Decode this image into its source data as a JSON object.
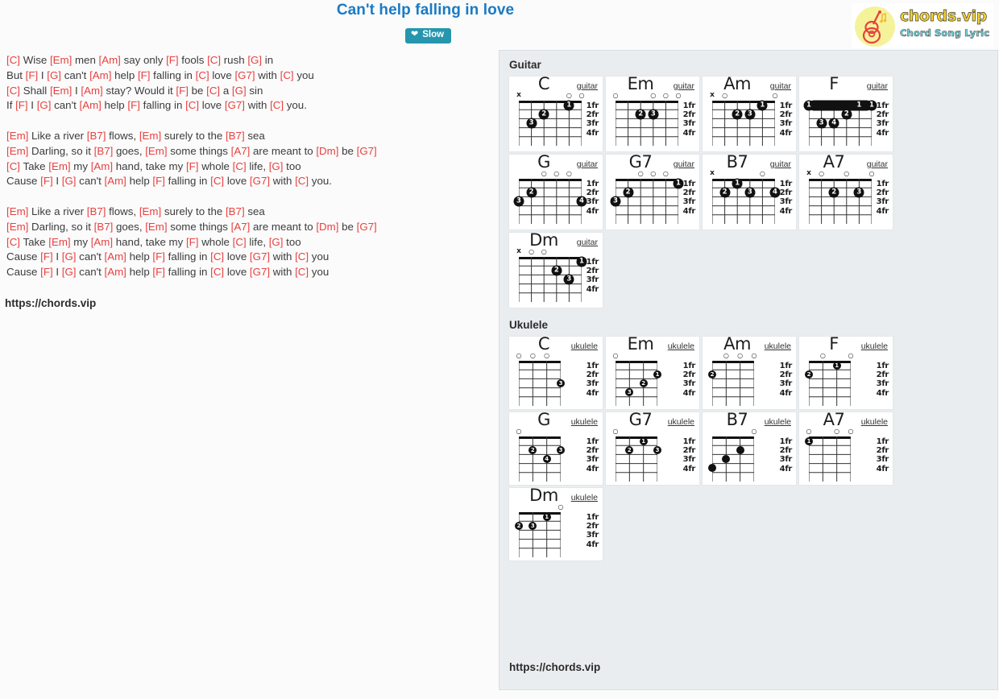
{
  "header": {
    "title": "Can't help falling in love",
    "slow_button": {
      "label": "Slow",
      "icon": "heart-beat-icon",
      "color": "#2596ae"
    }
  },
  "logo": {
    "name": "chords.vip",
    "tagline": "Chord Song Lyric",
    "icon": "guitar-icon",
    "name_color": "#f6d32d",
    "tagline_color": "#6fe0e8",
    "disc_color": "#f4f39a"
  },
  "colors": {
    "title": "#1a7ac4",
    "chord": "#e8413f",
    "panel_bg": "#e9edef"
  },
  "lyrics": {
    "url": "https://chords.vip",
    "lines": [
      [
        [
          "c",
          "[C]"
        ],
        [
          "t",
          " Wise "
        ],
        [
          "c",
          "[Em]"
        ],
        [
          "t",
          " men "
        ],
        [
          "c",
          "[Am]"
        ],
        [
          "t",
          " say only "
        ],
        [
          "c",
          "[F]"
        ],
        [
          "t",
          " fools "
        ],
        [
          "c",
          "[C]"
        ],
        [
          "t",
          " rush "
        ],
        [
          "c",
          "[G]"
        ],
        [
          "t",
          " in"
        ]
      ],
      [
        [
          "t",
          "But "
        ],
        [
          "c",
          "[F]"
        ],
        [
          "t",
          " I "
        ],
        [
          "c",
          "[G]"
        ],
        [
          "t",
          " can't "
        ],
        [
          "c",
          "[Am]"
        ],
        [
          "t",
          " help "
        ],
        [
          "c",
          "[F]"
        ],
        [
          "t",
          " falling in "
        ],
        [
          "c",
          "[C]"
        ],
        [
          "t",
          " love "
        ],
        [
          "c",
          "[G7]"
        ],
        [
          "t",
          " with "
        ],
        [
          "c",
          "[C]"
        ],
        [
          "t",
          " you"
        ]
      ],
      [
        [
          "c",
          "[C]"
        ],
        [
          "t",
          " Shall "
        ],
        [
          "c",
          "[Em]"
        ],
        [
          "t",
          " I "
        ],
        [
          "c",
          "[Am]"
        ],
        [
          "t",
          " stay? Would it "
        ],
        [
          "c",
          "[F]"
        ],
        [
          "t",
          " be "
        ],
        [
          "c",
          "[C]"
        ],
        [
          "t",
          " a "
        ],
        [
          "c",
          "[G]"
        ],
        [
          "t",
          " sin"
        ]
      ],
      [
        [
          "t",
          "If "
        ],
        [
          "c",
          "[F]"
        ],
        [
          "t",
          " I "
        ],
        [
          "c",
          "[G]"
        ],
        [
          "t",
          " can't "
        ],
        [
          "c",
          "[Am]"
        ],
        [
          "t",
          " help "
        ],
        [
          "c",
          "[F]"
        ],
        [
          "t",
          " falling in "
        ],
        [
          "c",
          "[C]"
        ],
        [
          "t",
          " love "
        ],
        [
          "c",
          "[G7]"
        ],
        [
          "t",
          " with "
        ],
        [
          "c",
          "[C]"
        ],
        [
          "t",
          " you."
        ]
      ],
      [],
      [
        [
          "c",
          "[Em]"
        ],
        [
          "t",
          " Like a river "
        ],
        [
          "c",
          "[B7]"
        ],
        [
          "t",
          " flows, "
        ],
        [
          "c",
          "[Em]"
        ],
        [
          "t",
          " surely to the "
        ],
        [
          "c",
          "[B7]"
        ],
        [
          "t",
          " sea"
        ]
      ],
      [
        [
          "c",
          "[Em]"
        ],
        [
          "t",
          " Darling, so it "
        ],
        [
          "c",
          "[B7]"
        ],
        [
          "t",
          " goes, "
        ],
        [
          "c",
          "[Em]"
        ],
        [
          "t",
          " some things "
        ],
        [
          "c",
          "[A7]"
        ],
        [
          "t",
          " are meant to "
        ],
        [
          "c",
          "[Dm]"
        ],
        [
          "t",
          " be "
        ],
        [
          "c",
          "[G7]"
        ]
      ],
      [
        [
          "c",
          "[C]"
        ],
        [
          "t",
          " Take "
        ],
        [
          "c",
          "[Em]"
        ],
        [
          "t",
          " my "
        ],
        [
          "c",
          "[Am]"
        ],
        [
          "t",
          " hand, take my "
        ],
        [
          "c",
          "[F]"
        ],
        [
          "t",
          " whole "
        ],
        [
          "c",
          "[C]"
        ],
        [
          "t",
          " life, "
        ],
        [
          "c",
          "[G]"
        ],
        [
          "t",
          " too"
        ]
      ],
      [
        [
          "t",
          "Cause "
        ],
        [
          "c",
          "[F]"
        ],
        [
          "t",
          " I "
        ],
        [
          "c",
          "[G]"
        ],
        [
          "t",
          " can't "
        ],
        [
          "c",
          "[Am]"
        ],
        [
          "t",
          " help "
        ],
        [
          "c",
          "[F]"
        ],
        [
          "t",
          " falling in "
        ],
        [
          "c",
          "[C]"
        ],
        [
          "t",
          " love "
        ],
        [
          "c",
          "[G7]"
        ],
        [
          "t",
          " with "
        ],
        [
          "c",
          "[C]"
        ],
        [
          "t",
          " you."
        ]
      ],
      [],
      [
        [
          "c",
          "[Em]"
        ],
        [
          "t",
          " Like a river "
        ],
        [
          "c",
          "[B7]"
        ],
        [
          "t",
          " flows, "
        ],
        [
          "c",
          "[Em]"
        ],
        [
          "t",
          " surely to the "
        ],
        [
          "c",
          "[B7]"
        ],
        [
          "t",
          " sea"
        ]
      ],
      [
        [
          "c",
          "[Em]"
        ],
        [
          "t",
          " Darling, so it "
        ],
        [
          "c",
          "[B7]"
        ],
        [
          "t",
          " goes, "
        ],
        [
          "c",
          "[Em]"
        ],
        [
          "t",
          " some things "
        ],
        [
          "c",
          "[A7]"
        ],
        [
          "t",
          " are meant to "
        ],
        [
          "c",
          "[Dm]"
        ],
        [
          "t",
          " be "
        ],
        [
          "c",
          "[G7]"
        ]
      ],
      [
        [
          "c",
          "[C]"
        ],
        [
          "t",
          " Take "
        ],
        [
          "c",
          "[Em]"
        ],
        [
          "t",
          " my "
        ],
        [
          "c",
          "[Am]"
        ],
        [
          "t",
          " hand, take my "
        ],
        [
          "c",
          "[F]"
        ],
        [
          "t",
          " whole "
        ],
        [
          "c",
          "[C]"
        ],
        [
          "t",
          " life, "
        ],
        [
          "c",
          "[G]"
        ],
        [
          "t",
          " too"
        ]
      ],
      [
        [
          "t",
          "Cause "
        ],
        [
          "c",
          "[F]"
        ],
        [
          "t",
          " I "
        ],
        [
          "c",
          "[G]"
        ],
        [
          "t",
          " can't "
        ],
        [
          "c",
          "[Am]"
        ],
        [
          "t",
          " help "
        ],
        [
          "c",
          "[F]"
        ],
        [
          "t",
          " falling in "
        ],
        [
          "c",
          "[C]"
        ],
        [
          "t",
          " love "
        ],
        [
          "c",
          "[G7]"
        ],
        [
          "t",
          " with "
        ],
        [
          "c",
          "[C]"
        ],
        [
          "t",
          " you"
        ]
      ],
      [
        [
          "t",
          "Cause "
        ],
        [
          "c",
          "[F]"
        ],
        [
          "t",
          " I "
        ],
        [
          "c",
          "[G]"
        ],
        [
          "t",
          " can't "
        ],
        [
          "c",
          "[Am]"
        ],
        [
          "t",
          " help "
        ],
        [
          "c",
          "[F]"
        ],
        [
          "t",
          " falling in "
        ],
        [
          "c",
          "[C]"
        ],
        [
          "t",
          " love "
        ],
        [
          "c",
          "[G7]"
        ],
        [
          "t",
          " with "
        ],
        [
          "c",
          "[C]"
        ],
        [
          "t",
          " you"
        ]
      ]
    ]
  },
  "chord_panel": {
    "url": "https://chords.vip",
    "fret_labels": [
      "1fr",
      "2fr",
      "3fr",
      "4fr"
    ],
    "sections": [
      {
        "title": "Guitar",
        "instrument_label": "guitar",
        "strings": 6,
        "chords": [
          {
            "name": "C",
            "markers": [
              "x",
              "",
              "",
              "",
              "o",
              "o"
            ],
            "dots": [
              {
                "s": 5,
                "f": 1,
                "n": "1"
              },
              {
                "s": 3,
                "f": 2,
                "n": "2"
              },
              {
                "s": 2,
                "f": 3,
                "n": "3"
              }
            ]
          },
          {
            "name": "Em",
            "markers": [
              "o",
              "",
              "",
              "o",
              "o",
              "o"
            ],
            "dots": [
              {
                "s": 3,
                "f": 2,
                "n": "2"
              },
              {
                "s": 4,
                "f": 2,
                "n": "3"
              }
            ]
          },
          {
            "name": "Am",
            "markers": [
              "x",
              "o",
              "",
              "",
              "",
              "o"
            ],
            "dots": [
              {
                "s": 5,
                "f": 1,
                "n": "1"
              },
              {
                "s": 3,
                "f": 2,
                "n": "2"
              },
              {
                "s": 4,
                "f": 2,
                "n": "3"
              }
            ]
          },
          {
            "name": "F",
            "markers": [
              "",
              "",
              "",
              "",
              "",
              ""
            ],
            "barre": {
              "f": 1,
              "from": 1,
              "to": 6
            },
            "dots": [
              {
                "s": 1,
                "f": 1,
                "n": "1"
              },
              {
                "s": 5,
                "f": 1,
                "n": "1"
              },
              {
                "s": 6,
                "f": 1,
                "n": "1"
              },
              {
                "s": 4,
                "f": 2,
                "n": "2"
              },
              {
                "s": 2,
                "f": 3,
                "n": "3"
              },
              {
                "s": 3,
                "f": 3,
                "n": "4"
              }
            ]
          },
          {
            "name": "G",
            "markers": [
              "",
              "",
              "o",
              "o",
              "o",
              ""
            ],
            "dots": [
              {
                "s": 2,
                "f": 2,
                "n": "2"
              },
              {
                "s": 1,
                "f": 3,
                "n": "3"
              },
              {
                "s": 6,
                "f": 3,
                "n": "4"
              }
            ]
          },
          {
            "name": "G7",
            "markers": [
              "",
              "",
              "o",
              "o",
              "o",
              ""
            ],
            "dots": [
              {
                "s": 6,
                "f": 1,
                "n": "1"
              },
              {
                "s": 2,
                "f": 2,
                "n": "2"
              },
              {
                "s": 1,
                "f": 3,
                "n": "3"
              }
            ]
          },
          {
            "name": "B7",
            "markers": [
              "x",
              "",
              "",
              "",
              "o",
              ""
            ],
            "dots": [
              {
                "s": 3,
                "f": 1,
                "n": "1"
              },
              {
                "s": 2,
                "f": 2,
                "n": "2"
              },
              {
                "s": 4,
                "f": 2,
                "n": "3"
              },
              {
                "s": 6,
                "f": 2,
                "n": "4"
              }
            ]
          },
          {
            "name": "A7",
            "markers": [
              "x",
              "o",
              "",
              "o",
              "",
              "o"
            ],
            "dots": [
              {
                "s": 3,
                "f": 2,
                "n": "2"
              },
              {
                "s": 5,
                "f": 2,
                "n": "3"
              }
            ]
          },
          {
            "name": "Dm",
            "markers": [
              "x",
              "o",
              "o",
              "",
              "",
              ""
            ],
            "dots": [
              {
                "s": 6,
                "f": 1,
                "n": "1"
              },
              {
                "s": 4,
                "f": 2,
                "n": "2"
              },
              {
                "s": 5,
                "f": 3,
                "n": "3"
              }
            ]
          }
        ]
      },
      {
        "title": "Ukulele",
        "instrument_label": "ukulele",
        "strings": 4,
        "chords": [
          {
            "name": "C",
            "markers": [
              "o",
              "o",
              "o",
              ""
            ],
            "dots": [
              {
                "s": 4,
                "f": 3,
                "n": "3"
              }
            ]
          },
          {
            "name": "Em",
            "markers": [
              "o",
              "",
              "",
              ""
            ],
            "dots": [
              {
                "s": 4,
                "f": 2,
                "n": "1"
              },
              {
                "s": 3,
                "f": 3,
                "n": "2"
              },
              {
                "s": 2,
                "f": 4,
                "n": "3"
              }
            ]
          },
          {
            "name": "Am",
            "markers": [
              "",
              "o",
              "o",
              "o"
            ],
            "dots": [
              {
                "s": 1,
                "f": 2,
                "n": "2"
              }
            ]
          },
          {
            "name": "F",
            "markers": [
              "",
              "o",
              "",
              "o"
            ],
            "dots": [
              {
                "s": 3,
                "f": 1,
                "n": "1"
              },
              {
                "s": 1,
                "f": 2,
                "n": "2"
              }
            ]
          },
          {
            "name": "G",
            "markers": [
              "o",
              "",
              "",
              ""
            ],
            "dots": [
              {
                "s": 2,
                "f": 2,
                "n": "2"
              },
              {
                "s": 4,
                "f": 2,
                "n": "3"
              },
              {
                "s": 3,
                "f": 3,
                "n": "4"
              }
            ]
          },
          {
            "name": "G7",
            "markers": [
              "o",
              "",
              "",
              ""
            ],
            "dots": [
              {
                "s": 3,
                "f": 1,
                "n": "1"
              },
              {
                "s": 2,
                "f": 2,
                "n": "2"
              },
              {
                "s": 4,
                "f": 2,
                "n": "3"
              }
            ]
          },
          {
            "name": "B7",
            "markers": [
              "",
              "",
              "",
              "o"
            ],
            "dots": [
              {
                "s": 3,
                "f": 2,
                "n": ""
              },
              {
                "s": 2,
                "f": 3,
                "n": ""
              },
              {
                "s": 1,
                "f": 4,
                "n": ""
              }
            ]
          },
          {
            "name": "A7",
            "markers": [
              "o",
              "",
              "o",
              "o"
            ],
            "dots": [
              {
                "s": 1,
                "f": 1,
                "n": "1"
              }
            ]
          },
          {
            "name": "Dm",
            "markers": [
              "",
              "",
              "",
              "o"
            ],
            "dots": [
              {
                "s": 3,
                "f": 1,
                "n": "1"
              },
              {
                "s": 1,
                "f": 2,
                "n": "2"
              },
              {
                "s": 2,
                "f": 2,
                "n": "3"
              }
            ]
          }
        ]
      }
    ]
  }
}
